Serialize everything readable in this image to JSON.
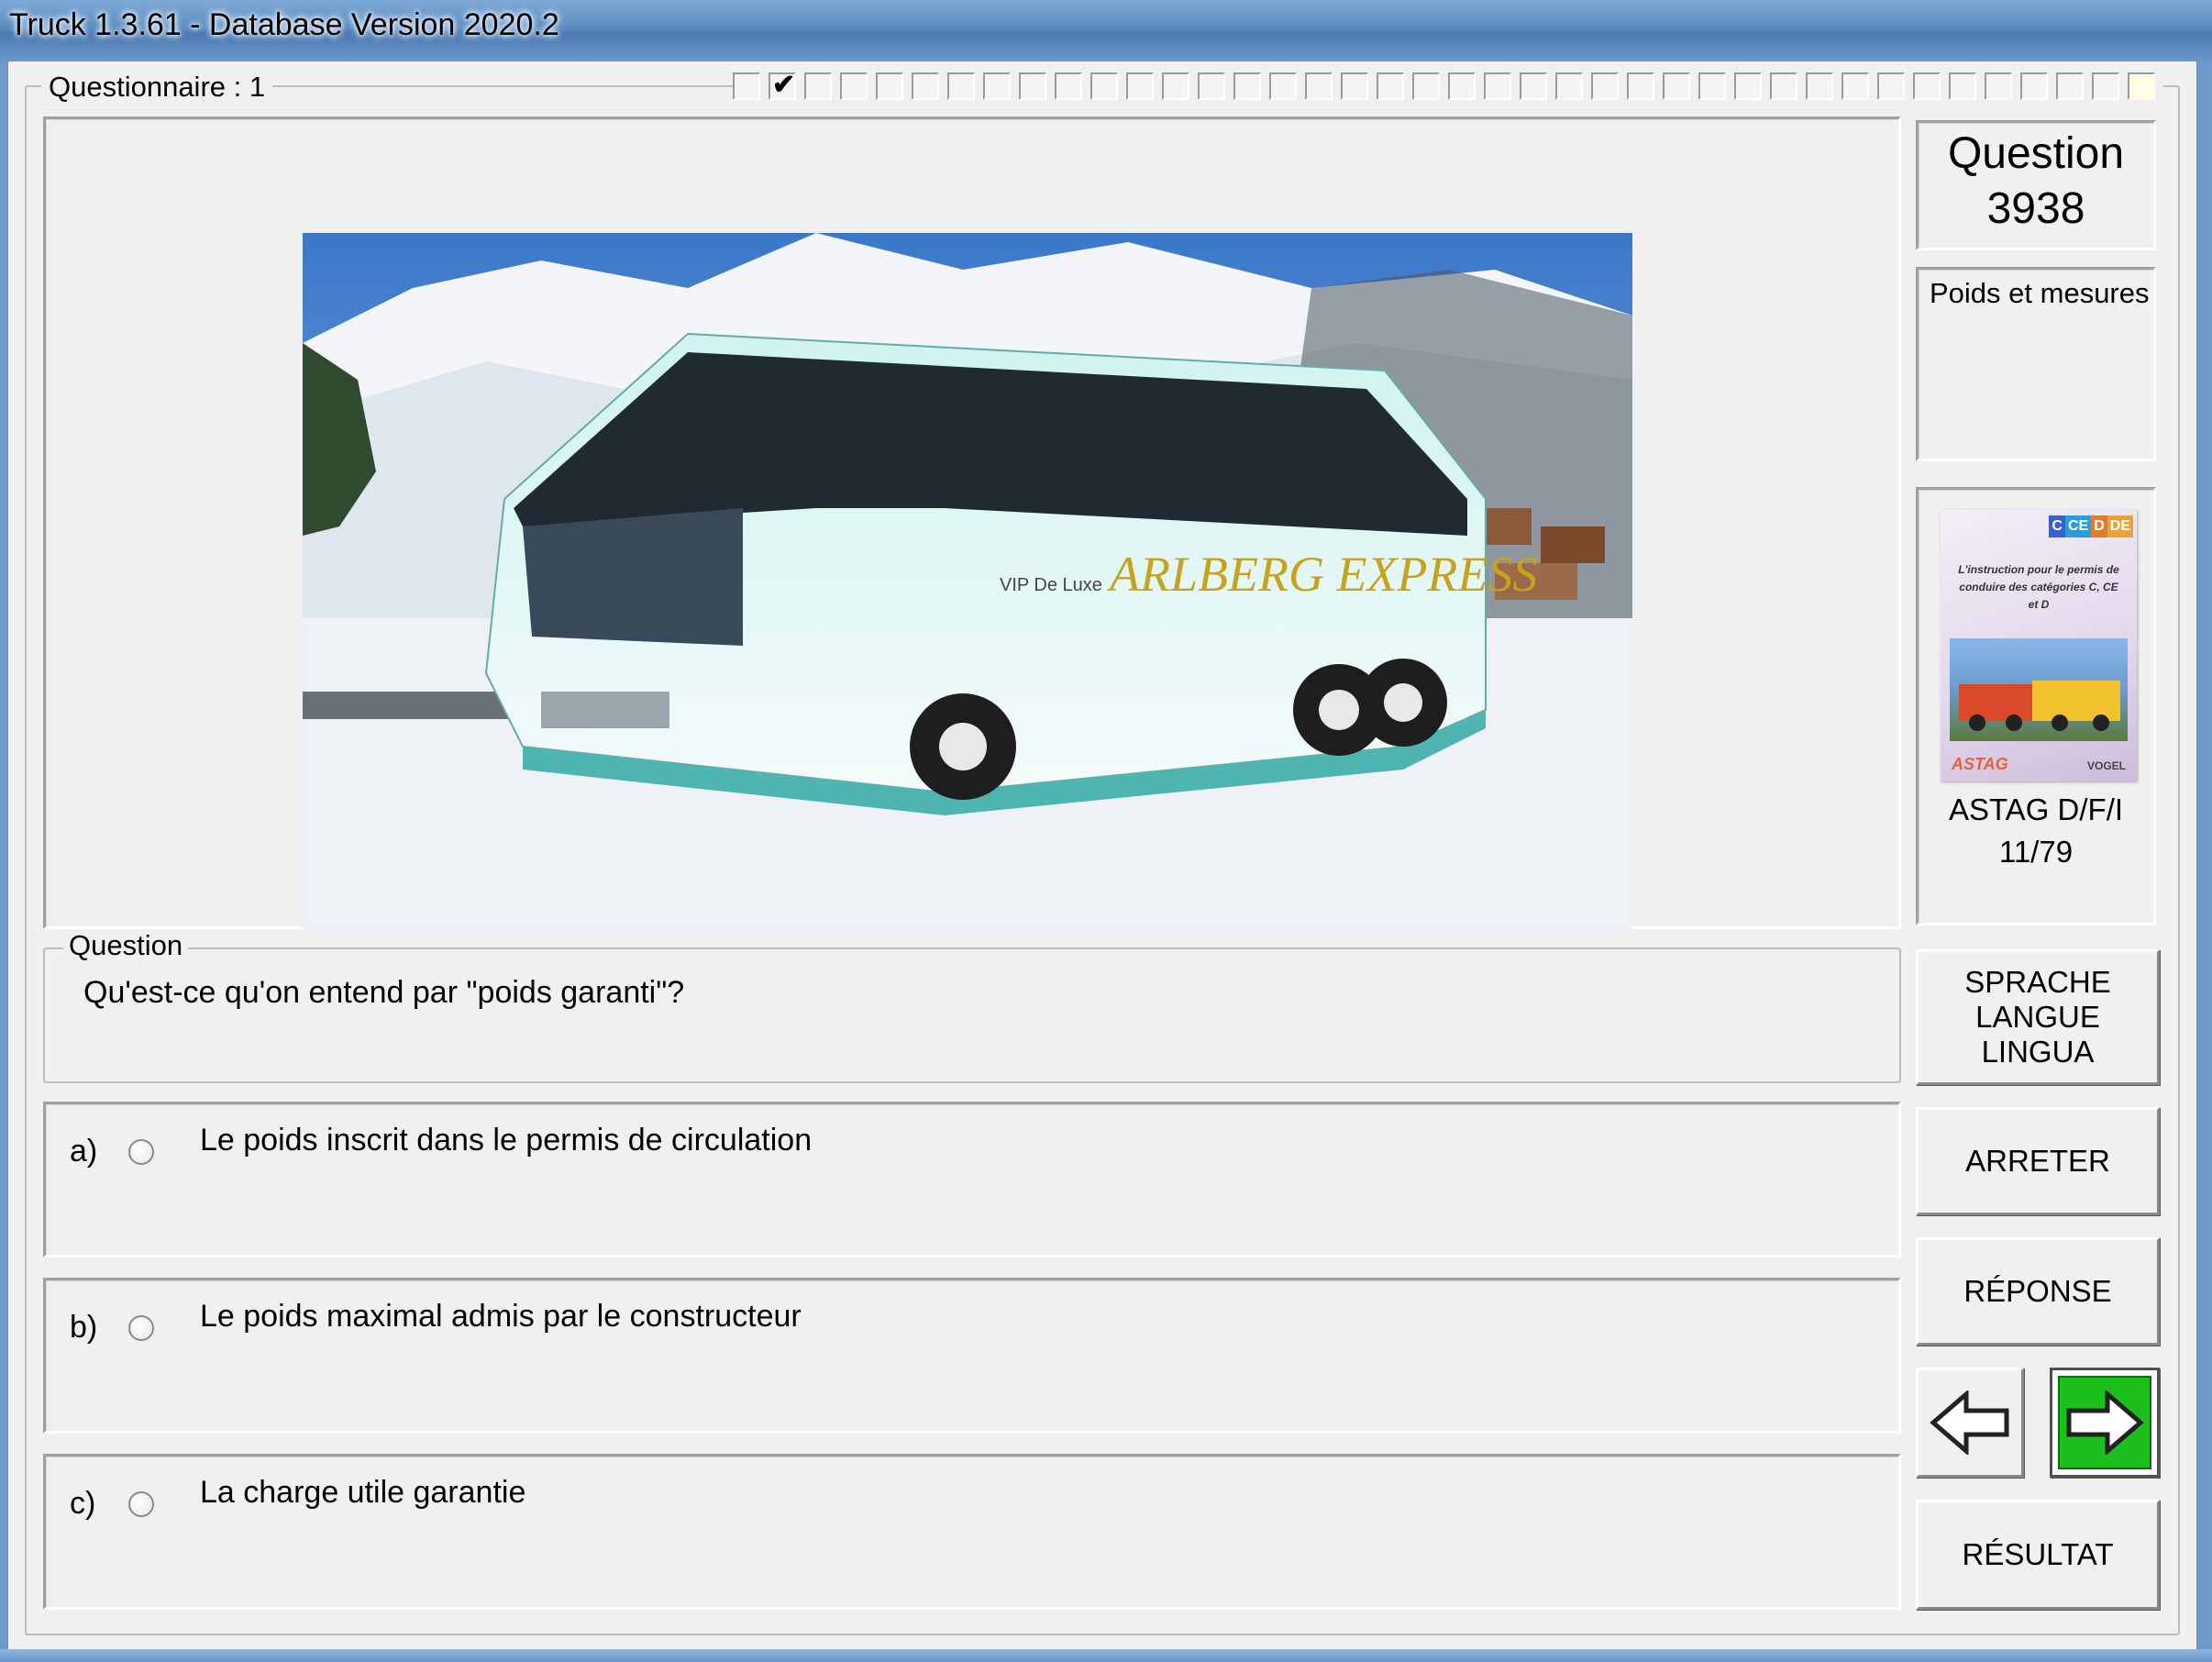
{
  "window": {
    "title": "Truck 1.3.61 - Database Version 2020.2"
  },
  "questionnaire": {
    "label": "Questionnaire : 1",
    "progress_cells": 40,
    "answered_cells": [
      1
    ],
    "current_cell": 39
  },
  "question": {
    "number_label": "Question",
    "number": "3938",
    "category": "Poids et mesures",
    "group_label": "Question",
    "text": "Qu'est-ce qu'on entend par \"poids garanti\"?"
  },
  "image": {
    "subject": "Coach bus in snowy mountains",
    "bus_text": "ARLBERG EXPRESS",
    "bus_subtext": "VIP De Luxe"
  },
  "answers": [
    {
      "letter": "a)",
      "text": "Le poids inscrit dans le permis de circulation"
    },
    {
      "letter": "b)",
      "text": "Le poids maximal admis par le constructeur"
    },
    {
      "letter": "c)",
      "text": "La charge utile garantie"
    }
  ],
  "book": {
    "tags": [
      "C",
      "CE",
      "D",
      "DE"
    ],
    "tag_colors": [
      "#3b5fd1",
      "#2a9fd6",
      "#e07b2f",
      "#e8a23a"
    ],
    "blurb": "L'instruction pour le permis de conduire des catégories C, CE et D",
    "logo_left": "ASTAG",
    "logo_right": "VOGEL",
    "caption_line1": "ASTAG D/F/I",
    "caption_line2": "11/79"
  },
  "buttons": {
    "language_line1": "SPRACHE",
    "language_line2": "LANGUE",
    "language_line3": "LINGUA",
    "stop": "ARRETER",
    "answer": "RÉPONSE",
    "result": "RÉSULTAT",
    "prev_icon": "arrow-left-icon",
    "next_icon": "arrow-right-icon"
  },
  "colors": {
    "next_button": "#1dbf1d",
    "window_bg": "#f0f0f0"
  }
}
